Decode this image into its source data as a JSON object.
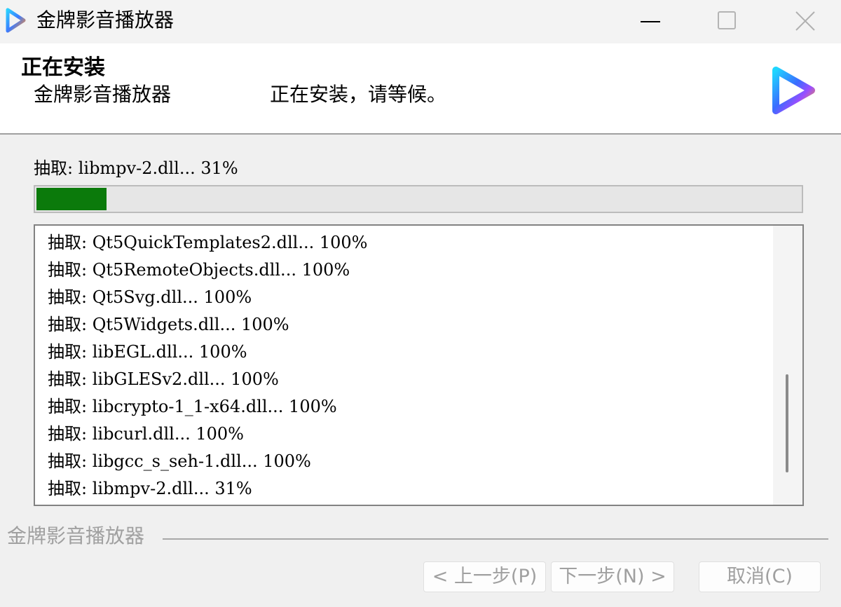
{
  "window": {
    "title": "金牌影音播放器"
  },
  "header": {
    "title": "正在安装",
    "app_name": "金牌影音播放器",
    "message": "正在安装，请等候。"
  },
  "status": {
    "text": "抽取: libmpv-2.dll... 31%",
    "progress_percent": 31
  },
  "log": {
    "items": [
      "抽取: Qt5QuickTemplates2.dll... 100%",
      "抽取: Qt5RemoteObjects.dll... 100%",
      "抽取: Qt5Svg.dll... 100%",
      "抽取: Qt5Widgets.dll... 100%",
      "抽取: libEGL.dll... 100%",
      "抽取: libGLESv2.dll... 100%",
      "抽取: libcrypto-1_1-x64.dll... 100%",
      "抽取: libcurl.dll... 100%",
      "抽取: libgcc_s_seh-1.dll... 100%",
      "抽取: libmpv-2.dll... 31%"
    ]
  },
  "footer": {
    "brand": "金牌影音播放器"
  },
  "buttons": {
    "back": "< 上一步(P)",
    "next": "下一步(N) >",
    "cancel": "取消(C)"
  },
  "colors": {
    "progress_fill": "#0b7a0b",
    "progress_track": "#e6e6e6",
    "header_bg": "#ffffff",
    "window_bg": "#f0f0f0",
    "disabled_text": "#a0a0a0"
  },
  "icons": {
    "app": "play-triangle-logo-icon",
    "minimize": "minimize-icon",
    "maximize": "maximize-icon",
    "close": "close-icon"
  }
}
